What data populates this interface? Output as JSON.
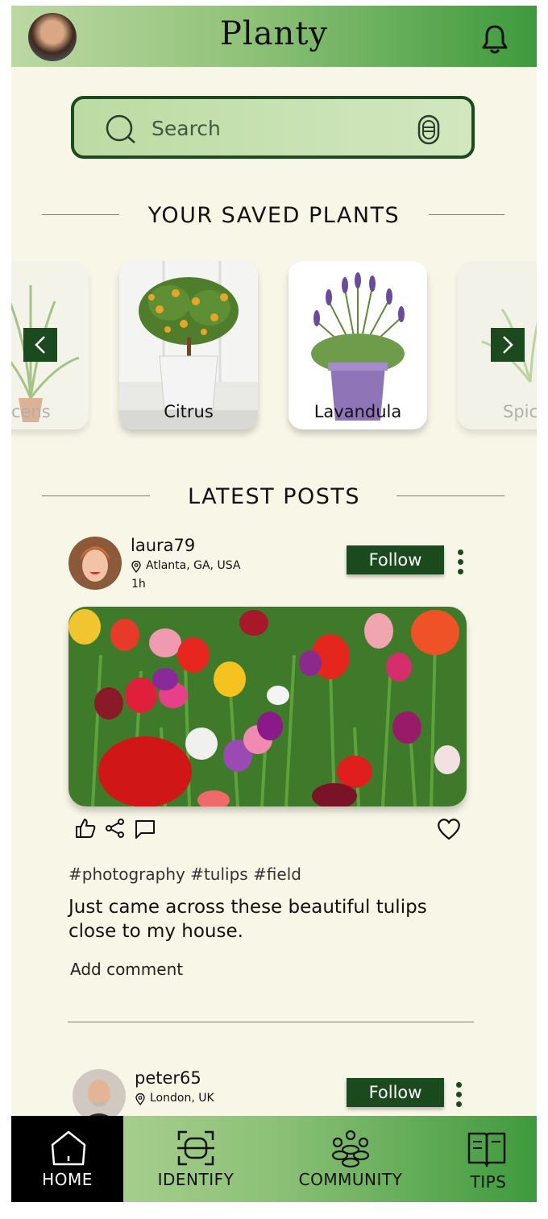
{
  "header": {
    "title": "Planty"
  },
  "search": {
    "placeholder": "Search"
  },
  "saved": {
    "title": "YOUR SAVED PLANTS",
    "cards": [
      {
        "label": "cens"
      },
      {
        "label": "Citrus"
      },
      {
        "label": "Lavandula"
      },
      {
        "label": "Spic"
      }
    ]
  },
  "latest": {
    "title": "LATEST POSTS"
  },
  "posts": [
    {
      "username": "laura79",
      "location": "Atlanta, GA, USA",
      "time": "1h",
      "follow": "Follow",
      "hashtags": "#photography #tulips #field",
      "caption": "Just came across these beautiful tulips close to my house.",
      "comment_placeholder": "Add comment"
    },
    {
      "username": "peter65",
      "location": "London, UK",
      "follow": "Follow"
    }
  ],
  "nav": [
    {
      "label": "HOME",
      "icon": "home-icon",
      "active": true
    },
    {
      "label": "IDENTIFY",
      "icon": "scan-icon"
    },
    {
      "label": "COMMUNITY",
      "icon": "community-icon"
    },
    {
      "label": "TIPS",
      "icon": "book-icon"
    }
  ],
  "colors": {
    "accent": "#1b4a1f",
    "background": "#f8f6e6",
    "header_start": "#bdd8a3",
    "header_end": "#3f9a3d"
  }
}
